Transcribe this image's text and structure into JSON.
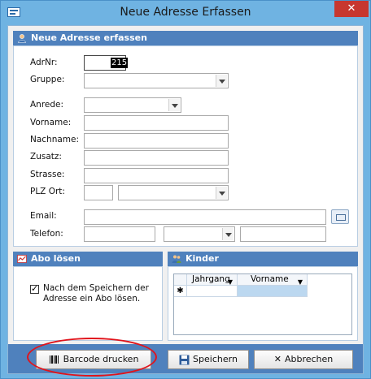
{
  "window": {
    "title": "Neue Adresse Erfassen",
    "close_glyph": "✕"
  },
  "section_address": {
    "title": "Neue Adresse erfassen",
    "icon": "person-icon"
  },
  "labels": {
    "adrnr": "AdrNr:",
    "gruppe": "Gruppe:",
    "anrede": "Anrede:",
    "vorname": "Vorname:",
    "nachname": "Nachname:",
    "zusatz": "Zusatz:",
    "strasse": "Strasse:",
    "plz_ort": "PLZ Ort:",
    "email": "Email:",
    "telefon": "Telefon:"
  },
  "values": {
    "adrnr": "215"
  },
  "section_abo": {
    "title": "Abo lösen",
    "icon": "chart-icon",
    "checkbox_label": "Nach dem Speichern der Adresse ein Abo lösen.",
    "checked": true
  },
  "section_kinder": {
    "title": "Kinder",
    "icon": "people-icon",
    "columns": [
      "Jahrgang",
      "Vorname"
    ],
    "new_row_marker": "✱"
  },
  "footer": {
    "barcode_label": "Barcode drucken",
    "save_label": "Speichern",
    "cancel_label": "Abbrechen"
  },
  "colors": {
    "accent": "#4f81bd",
    "highlight": "#e0141c",
    "window_frame": "#6fb3e2"
  }
}
